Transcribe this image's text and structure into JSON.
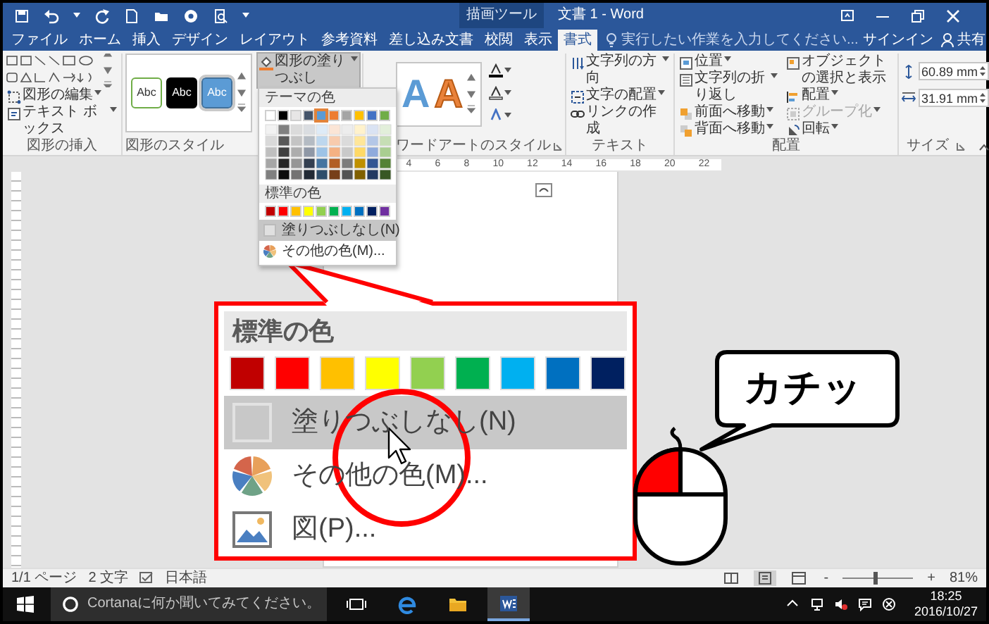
{
  "title_bar": {
    "context_label": "描画ツール",
    "title": "文書 1 - Word"
  },
  "tabs": [
    {
      "label": "ファイル",
      "selected": false
    },
    {
      "label": "ホーム",
      "selected": false
    },
    {
      "label": "挿入",
      "selected": false
    },
    {
      "label": "デザイン",
      "selected": false
    },
    {
      "label": "レイアウト",
      "selected": false
    },
    {
      "label": "参考資料",
      "selected": false
    },
    {
      "label": "差し込み文書",
      "selected": false
    },
    {
      "label": "校閲",
      "selected": false
    },
    {
      "label": "表示",
      "selected": false
    },
    {
      "label": "書式",
      "selected": true
    }
  ],
  "search": {
    "placeholder": "実行したい作業を入力してください..."
  },
  "account": {
    "sign_in": "サインイン",
    "share": "共有"
  },
  "ribbon": {
    "groups": [
      {
        "kind": "insert_shapes",
        "label": "図形の挿入",
        "launcher": false,
        "buttons": [
          {
            "label": "図形の編集",
            "has_menu": true
          },
          {
            "label": "テキスト ボックス",
            "has_menu": true
          }
        ]
      },
      {
        "kind": "shape_styles",
        "label": "図形のスタイル",
        "launcher": false,
        "fill_button": {
          "label": "図形の塗りつぶし",
          "has_menu": true,
          "pressed": true
        },
        "styles": [
          {
            "text": "Abc",
            "kind": "light"
          },
          {
            "text": "Abc",
            "kind": "dark"
          },
          {
            "text": "Abc",
            "kind": "accent"
          }
        ]
      },
      {
        "kind": "wordart",
        "label": "ワードアートのスタイル",
        "launcher": true,
        "samples": [
          {
            "text": "A",
            "kind": "fill"
          },
          {
            "text": "A",
            "kind": "outline"
          }
        ]
      },
      {
        "kind": "text",
        "label": "テキスト",
        "launcher": false,
        "buttons": [
          {
            "label": "文字列の方向",
            "has_menu": true
          },
          {
            "label": "文字の配置",
            "has_menu": true
          },
          {
            "label": "リンクの作成",
            "has_menu": false
          }
        ]
      },
      {
        "kind": "arrange",
        "label": "配置",
        "launcher": false,
        "columns": [
          [
            {
              "label": "位置",
              "has_menu": true,
              "disabled": false
            },
            {
              "label": "文字列の折り返し",
              "has_menu": true,
              "disabled": false
            },
            {
              "label": "前面へ移動",
              "has_menu": true,
              "disabled": false
            },
            {
              "label": "背面へ移動",
              "has_menu": true,
              "disabled": false
            }
          ],
          [
            {
              "label": "オブジェクトの選択と表示",
              "has_menu": false,
              "disabled": false
            },
            {
              "label": "配置",
              "has_menu": true,
              "disabled": false
            },
            {
              "label": "グループ化",
              "has_menu": true,
              "disabled": true
            },
            {
              "label": "回転",
              "has_menu": true,
              "disabled": false
            }
          ]
        ]
      },
      {
        "kind": "size",
        "label": "サイズ",
        "launcher": true,
        "height": "60.89 mm",
        "width": "31.91 mm"
      }
    ]
  },
  "ruler": {
    "marks": [
      "4",
      "6",
      "8",
      "10",
      "12",
      "14",
      "16",
      "18",
      "20",
      "22"
    ]
  },
  "fill_menu": {
    "theme_header": "テーマの色",
    "theme_colors": [
      {
        "color": "#ffffff",
        "selected": false
      },
      {
        "color": "#000000",
        "selected": false
      },
      {
        "color": "#e7e6e6",
        "selected": false
      },
      {
        "color": "#44546a",
        "selected": false
      },
      {
        "color": "#5b9bd5",
        "selected": true
      },
      {
        "color": "#ed7d31",
        "selected": false
      },
      {
        "color": "#a5a5a5",
        "selected": false
      },
      {
        "color": "#ffc000",
        "selected": false
      },
      {
        "color": "#4472c4",
        "selected": false
      },
      {
        "color": "#70ad47",
        "selected": false
      }
    ],
    "standard_header": "標準の色",
    "standard_colors": [
      {
        "color": "#c00000"
      },
      {
        "color": "#ff0000"
      },
      {
        "color": "#ffc000"
      },
      {
        "color": "#ffff00"
      },
      {
        "color": "#92d050"
      },
      {
        "color": "#00b050"
      },
      {
        "color": "#00b0f0"
      },
      {
        "color": "#0070c0"
      },
      {
        "color": "#002060"
      },
      {
        "color": "#7030a0"
      }
    ],
    "items": [
      {
        "kind": "no_fill",
        "label": "塗りつぶしなし(N)",
        "highlighted": true
      },
      {
        "kind": "more_colors",
        "label": "その他の色(M)...",
        "highlighted": false
      }
    ]
  },
  "callout": {
    "header": "標準の色",
    "colors": [
      {
        "color": "#c00000"
      },
      {
        "color": "#ff0000"
      },
      {
        "color": "#ffc000"
      },
      {
        "color": "#ffff00"
      },
      {
        "color": "#92d050"
      },
      {
        "color": "#00b050"
      },
      {
        "color": "#00b0f0"
      },
      {
        "color": "#0070c0"
      },
      {
        "color": "#002060"
      }
    ],
    "items": [
      {
        "kind": "no_fill",
        "label": "塗りつぶしなし(N)",
        "highlighted": true
      },
      {
        "kind": "more_colors",
        "label": "その他の色(M)...",
        "highlighted": false
      },
      {
        "kind": "picture",
        "label": "図(P)...",
        "highlighted": false
      }
    ]
  },
  "bubble": {
    "text": "カチッ"
  },
  "mouse": {
    "left_pressed": true
  },
  "status_bar": {
    "page": "1/1 ページ",
    "words": "2 文字",
    "language": "日本語",
    "views": [
      {
        "kind": "read",
        "selected": false
      },
      {
        "kind": "print",
        "selected": true
      },
      {
        "kind": "web",
        "selected": false
      }
    ],
    "zoom": {
      "minus": "-",
      "plus": "+",
      "level": 0.45,
      "reading": "81%"
    }
  },
  "taskbar": {
    "search_placeholder": "Cortanaに何か聞いてみてください。",
    "apps": [
      {
        "kind": "task_view",
        "active": false
      },
      {
        "kind": "browser",
        "active": false
      },
      {
        "kind": "folder",
        "active": false
      },
      {
        "kind": "word",
        "active": true
      }
    ],
    "time": "18:25",
    "date": "2016/10/27"
  }
}
